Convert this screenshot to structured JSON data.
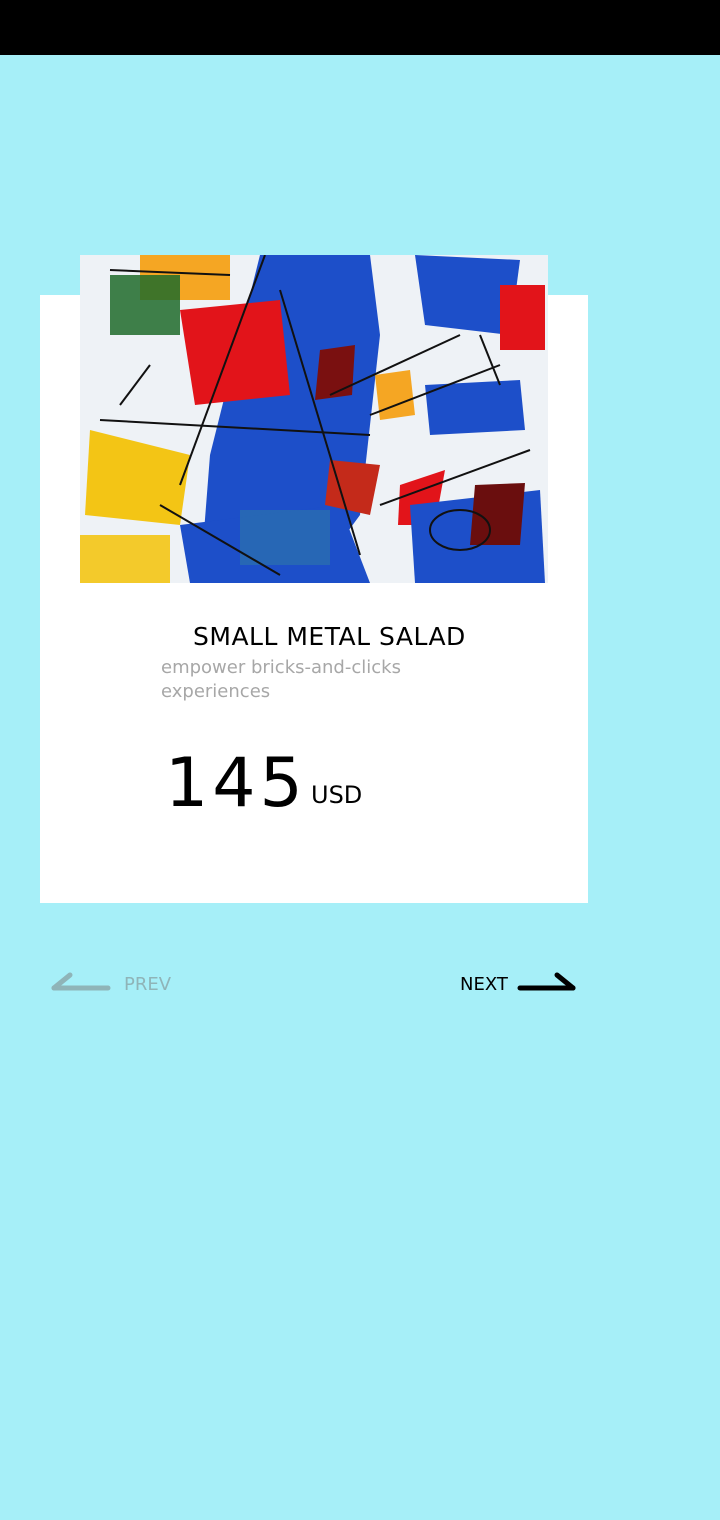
{
  "product": {
    "title": "SMALL METAL SALAD",
    "description": "empower bricks-and-clicks experiences",
    "price": "145",
    "currency": "USD",
    "image_icon": "abstract-painting-image"
  },
  "navigation": {
    "prev_label": "PREV",
    "next_label": "NEXT",
    "prev_icon": "arrow-left-icon",
    "next_icon": "arrow-right-icon"
  },
  "colors": {
    "background": "#a6eff8",
    "card": "#ffffff",
    "status_bar": "#000000",
    "text_primary": "#000000",
    "text_muted": "#a7a7a7",
    "prev_disabled": "#8fb4b8"
  }
}
